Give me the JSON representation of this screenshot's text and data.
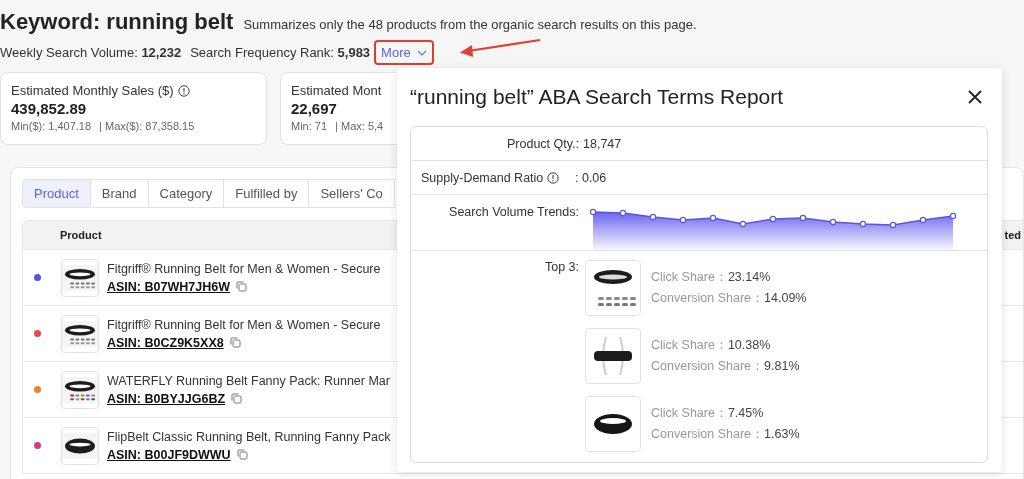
{
  "header": {
    "title": "Keyword: running belt",
    "note": "Summarizes only the 48 products from the organic search results on this page."
  },
  "stats": [
    {
      "label": "Weekly Search Volume:",
      "value": "12,232"
    },
    {
      "label": "Search Frequency Rank:",
      "value": "5,983"
    }
  ],
  "more_button": {
    "label": "More",
    "expanded": true
  },
  "cards": [
    {
      "label": "Estimated Monthly Sales ($)",
      "info": true,
      "value": "439,852.89",
      "min": "Min($): 1,407.18",
      "max": "| Max($): 87,358.15"
    },
    {
      "label": "Estimated Mont",
      "info": false,
      "value": "22,697",
      "min": "Min: 71",
      "max": "| Max: 5,4"
    }
  ],
  "tabs": [
    {
      "label": "Product",
      "selected": true
    },
    {
      "label": "Brand",
      "selected": false
    },
    {
      "label": "Category",
      "selected": false
    },
    {
      "label": "Fulfilled by",
      "selected": false
    },
    {
      "label": "Sellers' Co",
      "selected": false
    }
  ],
  "table": {
    "columns": [
      "Product",
      "ted"
    ],
    "rows": [
      {
        "color": "#4f56d8",
        "title": "Fitgriff® Running Belt for Men & Women - Secure",
        "asin": "ASIN: B07WH7JH6W"
      },
      {
        "color": "#e5484d",
        "title": "Fitgriff® Running Belt for Men & Women - Secure",
        "asin": "ASIN: B0CZ9K5XX8"
      },
      {
        "color": "#f07c3a",
        "title": "WATERFLY Running Belt Fanny Pack: Runner Mar",
        "asin": "ASIN: B0BYJJG6BZ"
      },
      {
        "color": "#d63a86",
        "title": "FlipBelt Classic Running Belt, Running Fanny Pack",
        "asin": "ASIN: B00JF9DWWU"
      }
    ]
  },
  "popup": {
    "title": "“running belt” ABA Search Terms Report",
    "rows": [
      {
        "kind": "text",
        "label": "Product Qty.:",
        "info": false,
        "value": "18,747"
      },
      {
        "kind": "text",
        "label": "Supply-Demand Ratio",
        "info": true,
        "value": ": 0.06"
      },
      {
        "kind": "trend",
        "label": "Search Volume Trends:"
      },
      {
        "kind": "top",
        "label": "Top 3:",
        "items": [
          {
            "click_label": "Click Share：",
            "click": "23.14%",
            "conv_label": "Conversion Share：",
            "conv": "14.09%"
          },
          {
            "click_label": "Click Share：",
            "click": "10.38%",
            "conv_label": "Conversion Share：",
            "conv": "9.81%"
          },
          {
            "click_label": "Click Share：",
            "click": "7.45%",
            "conv_label": "Conversion Share：",
            "conv": "1.63%"
          }
        ]
      }
    ]
  }
}
